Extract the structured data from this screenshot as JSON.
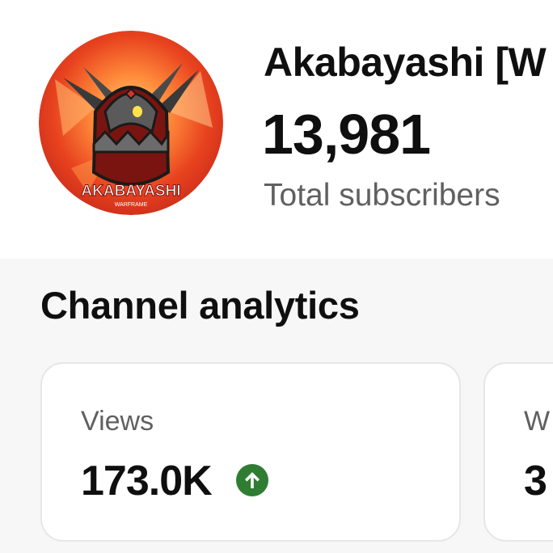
{
  "channel": {
    "name": "Akabayashi [W",
    "subscriber_count": "13,981",
    "subscriber_label": "Total subscribers",
    "avatar_text": "AKABAYASHI",
    "avatar_subtext": "WARFRAME"
  },
  "analytics": {
    "title": "Channel analytics",
    "cards": [
      {
        "label": "Views",
        "value": "173.0K",
        "trend": "up",
        "trend_icon": "arrow-up-circle-icon"
      },
      {
        "label": "W",
        "value": "3"
      }
    ]
  },
  "colors": {
    "trend_up": "#2e7d32",
    "secondary_text": "#606060",
    "avatar_bg": "#e8431f"
  }
}
